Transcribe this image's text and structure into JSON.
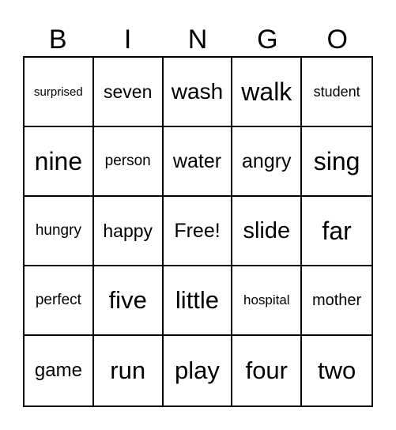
{
  "card": {
    "header": [
      "B",
      "I",
      "N",
      "G",
      "O"
    ],
    "rows": [
      [
        {
          "text": "surprised",
          "size": 15
        },
        {
          "text": "seven",
          "size": 23
        },
        {
          "text": "wash",
          "size": 28
        },
        {
          "text": "walk",
          "size": 32
        },
        {
          "text": "student",
          "size": 18
        }
      ],
      [
        {
          "text": "nine",
          "size": 32
        },
        {
          "text": "person",
          "size": 19
        },
        {
          "text": "water",
          "size": 25
        },
        {
          "text": "angry",
          "size": 25
        },
        {
          "text": "sing",
          "size": 32
        }
      ],
      [
        {
          "text": "hungry",
          "size": 19
        },
        {
          "text": "happy",
          "size": 23
        },
        {
          "text": "Free!",
          "size": 25
        },
        {
          "text": "slide",
          "size": 29
        },
        {
          "text": "far",
          "size": 32
        }
      ],
      [
        {
          "text": "perfect",
          "size": 19
        },
        {
          "text": "five",
          "size": 31
        },
        {
          "text": "little",
          "size": 31
        },
        {
          "text": "hospital",
          "size": 17
        },
        {
          "text": "mother",
          "size": 20
        }
      ],
      [
        {
          "text": "game",
          "size": 24
        },
        {
          "text": "run",
          "size": 31
        },
        {
          "text": "play",
          "size": 31
        },
        {
          "text": "four",
          "size": 31
        },
        {
          "text": "two",
          "size": 31
        }
      ]
    ]
  }
}
